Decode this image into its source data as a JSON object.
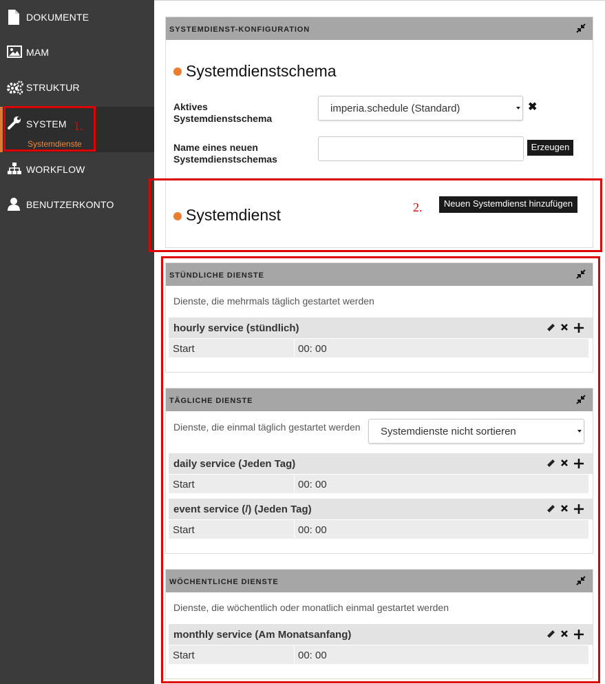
{
  "sidebar": {
    "items": [
      {
        "label": "DOKUMENTE",
        "icon": "document-icon"
      },
      {
        "label": "MAM",
        "icon": "image-icon"
      },
      {
        "label": "STRUKTUR",
        "icon": "gears-icon"
      },
      {
        "label": "SYSTEM",
        "icon": "wrench-icon",
        "active": true,
        "sub": "Systemdienste"
      },
      {
        "label": "WORKFLOW",
        "icon": "sitemap-icon"
      },
      {
        "label": "BENUTZERKONTO",
        "icon": "user-icon"
      }
    ]
  },
  "colors": {
    "sidebar_bg": "#3b3b3b",
    "accent_orange": "#ea7d2e",
    "panel_header": "#a6a6a6",
    "annotation_red": "#e00000"
  },
  "config_panel": {
    "title": "SYSTEMDIENST-KONFIGURATION",
    "schema_heading": "Systemdienstschema",
    "active_label_line1": "Aktives",
    "active_label_line2": "Systemdienstschema",
    "active_value": "imperia.schedule (Standard)",
    "new_label_line1": "Name eines neuen",
    "new_label_line2": "Systemdienstschemas",
    "new_value": "",
    "create_button": "Erzeugen",
    "service_heading": "Systemdienst",
    "add_service_button": "Neuen Systemdienst hinzufügen"
  },
  "annotations": {
    "one": "1.",
    "two": "2."
  },
  "groups": {
    "hourly": {
      "title": "STÜNDLICHE DIENSTE",
      "description": "Dienste, die mehrmals täglich gestartet werden",
      "services": [
        {
          "name": "hourly service (stündlich)",
          "key": "Start",
          "value": "00: 00"
        }
      ]
    },
    "daily": {
      "title": "TÄGLICHE DIENSTE",
      "description": "Dienste, die einmal täglich gestartet werden",
      "sort_value": "Systemdienste nicht sortieren",
      "services": [
        {
          "name": "daily service (Jeden Tag)",
          "key": "Start",
          "value": "00: 00"
        },
        {
          "name": "event service (/) (Jeden Tag)",
          "key": "Start",
          "value": "00: 00"
        }
      ]
    },
    "weekly": {
      "title": "WÖCHENTLICHE DIENSTE",
      "description": "Dienste, die wöchentlich oder monatlich einmal gestartet werden",
      "services": [
        {
          "name": "monthly service (Am Monatsanfang)",
          "key": "Start",
          "value": "00: 00"
        }
      ]
    }
  }
}
